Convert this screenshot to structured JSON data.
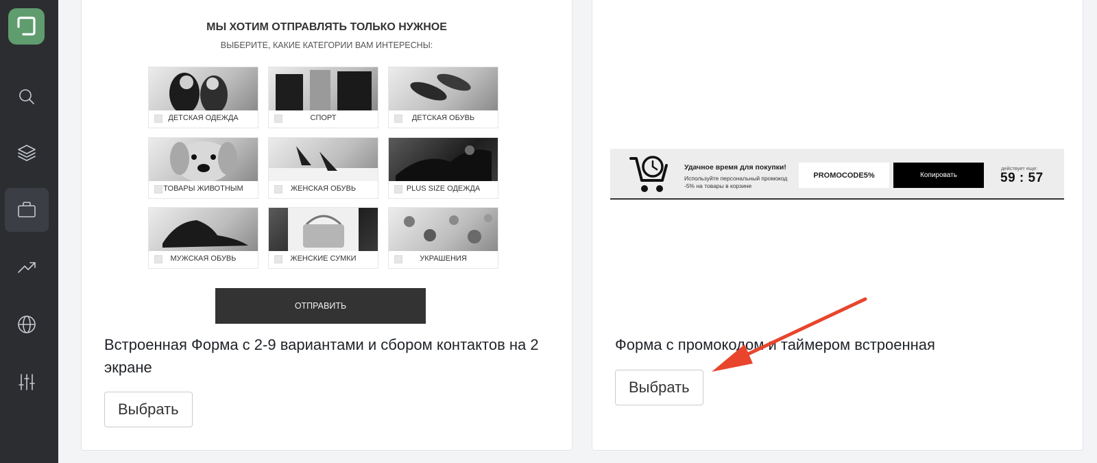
{
  "sidebar": {
    "items": [
      {
        "icon": "search-icon"
      },
      {
        "icon": "layers-icon"
      },
      {
        "icon": "briefcase-icon",
        "active": true
      },
      {
        "icon": "trending-up-icon"
      },
      {
        "icon": "globe-icon"
      },
      {
        "icon": "sliders-icon"
      }
    ],
    "accent": "#5f9c6e"
  },
  "cards": [
    {
      "preview": {
        "title": "МЫ ХОТИМ ОТПРАВЛЯТЬ ТОЛЬКО НУЖНОЕ",
        "subtitle": "ВЫБЕРИТЕ, КАКИЕ КАТЕГОРИИ ВАМ ИНТЕРЕСНЫ:",
        "categories": [
          "ДЕТСКАЯ ОДЕЖДА",
          "СПОРТ",
          "ДЕТСКАЯ ОБУВЬ",
          "ТОВАРЫ ЖИВОТНЫМ",
          "ЖЕНСКАЯ ОБУВЬ",
          "PLUS SIZE ОДЕЖДА",
          "МУЖСКАЯ ОБУВЬ",
          "ЖЕНСКИЕ СУМКИ",
          "УКРАШЕНИЯ"
        ],
        "submit_label": "ОТПРАВИТЬ"
      },
      "caption": "Встроенная Форма с 2-9 вариантами и сбором контактов на 2 экране",
      "select_label": "Выбрать"
    },
    {
      "preview": {
        "headline": "Удачное время для покупки!",
        "desc_line1": "Используйте персональный промокод",
        "desc_line2": "-5% на товары в корзине",
        "promocode": "PROMOCODE5%",
        "copy_label": "Копировать",
        "valid_label": "действует еще:",
        "timer": "59 : 57"
      },
      "caption": "Форма с промокодом и таймером встроенная",
      "select_label": "Выбрать"
    }
  ],
  "annotation_color": "#e8452c"
}
